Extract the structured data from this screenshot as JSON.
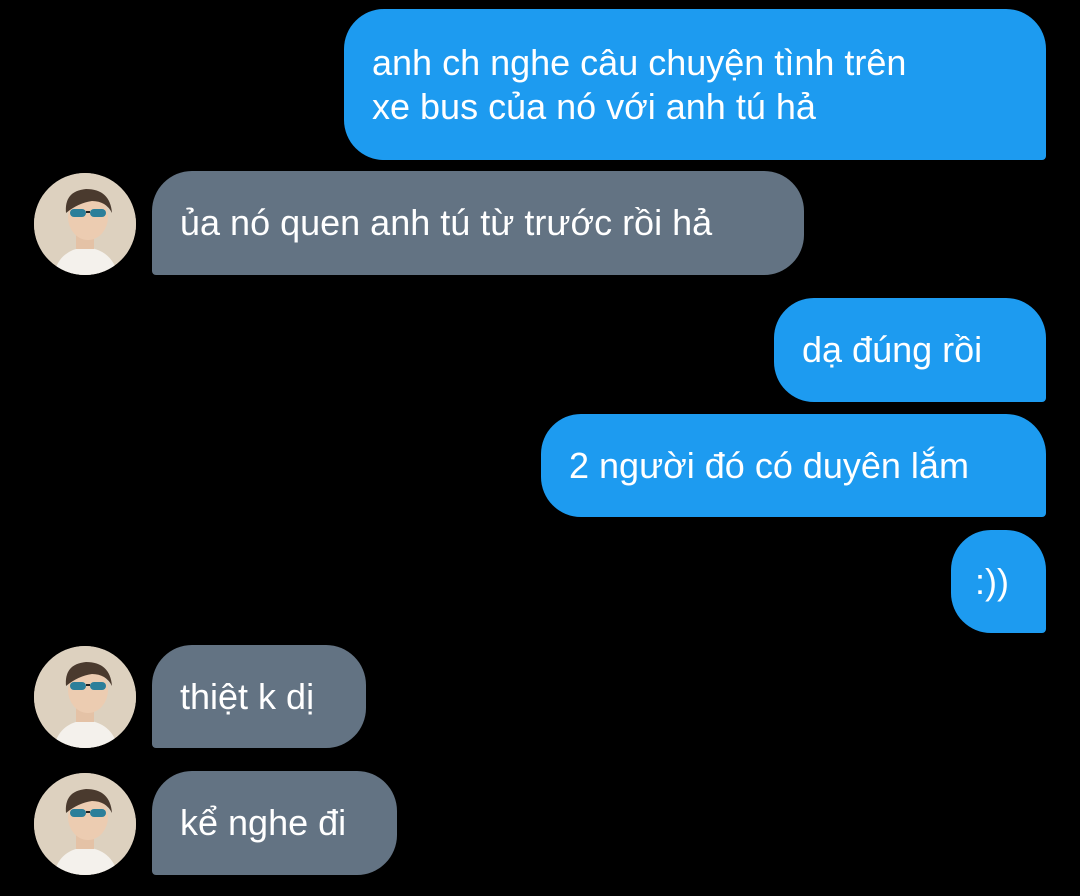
{
  "colors": {
    "background": "#000000",
    "outgoing_bubble": "#1d9bf0",
    "incoming_bubble": "#637383",
    "text": "#ffffff"
  },
  "contact": {
    "avatar_icon": "profile-photo-avatar"
  },
  "messages": [
    {
      "direction": "outgoing",
      "text": "anh ch nghe câu chuyện tình trên\nxe bus của nó với anh tú hả"
    },
    {
      "direction": "incoming",
      "text": "ủa nó quen anh tú từ trước rồi hả"
    },
    {
      "direction": "outgoing",
      "text": "dạ đúng rồi"
    },
    {
      "direction": "outgoing",
      "text": "2 người đó có duyên lắm"
    },
    {
      "direction": "outgoing",
      "text": ":))"
    },
    {
      "direction": "incoming",
      "text": "thiệt k dị"
    },
    {
      "direction": "incoming",
      "text": "kể nghe đi"
    }
  ]
}
